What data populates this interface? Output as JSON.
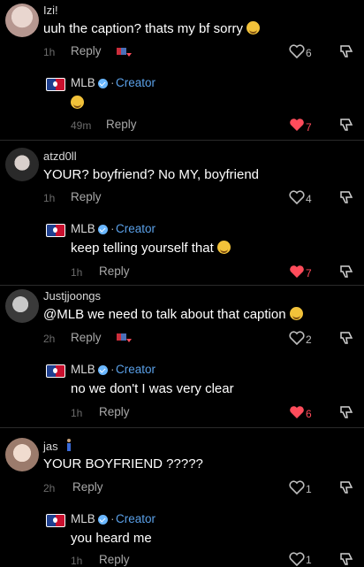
{
  "colors": {
    "accent_blue": "#5aa0e8",
    "heart_red": "#ff4c5b",
    "background": "#000000"
  },
  "comments": [
    {
      "user": "Izi!",
      "text": "uuh the caption? thats my bf sorry",
      "time": "1h",
      "reply_label": "Reply",
      "likes": "6",
      "liked": false,
      "reply": {
        "user": "MLB",
        "badge": "Creator",
        "text": "",
        "time": "49m",
        "reply_label": "Reply",
        "likes": "7",
        "liked": true
      }
    },
    {
      "user": "atzd0ll",
      "text": "YOUR? boyfriend? No MY, boyfriend",
      "time": "1h",
      "reply_label": "Reply",
      "likes": "4",
      "liked": false,
      "reply": {
        "user": "MLB",
        "badge": "Creator",
        "text": "keep telling yourself that",
        "time": "1h",
        "reply_label": "Reply",
        "likes": "7",
        "liked": true
      }
    },
    {
      "user": "Justjjoongs",
      "text": "@MLB we need to talk about that caption",
      "time": "2h",
      "reply_label": "Reply",
      "likes": "2",
      "liked": false,
      "reply": {
        "user": "MLB",
        "badge": "Creator",
        "text": "no we don't I was very clear",
        "time": "1h",
        "reply_label": "Reply",
        "likes": "6",
        "liked": true
      }
    },
    {
      "user": "jas",
      "text": "YOUR BOYFRIEND ?????",
      "time": "2h",
      "reply_label": "Reply",
      "likes": "1",
      "liked": false,
      "reply": {
        "user": "MLB",
        "badge": "Creator",
        "text": "you heard me",
        "time": "1h",
        "reply_label": "Reply",
        "likes": "1",
        "liked": false
      }
    }
  ],
  "icons": {
    "heart": "heart-icon",
    "dislike": "dislike-icon",
    "verified": "verified-icon",
    "sticker": "sticker-icon"
  }
}
